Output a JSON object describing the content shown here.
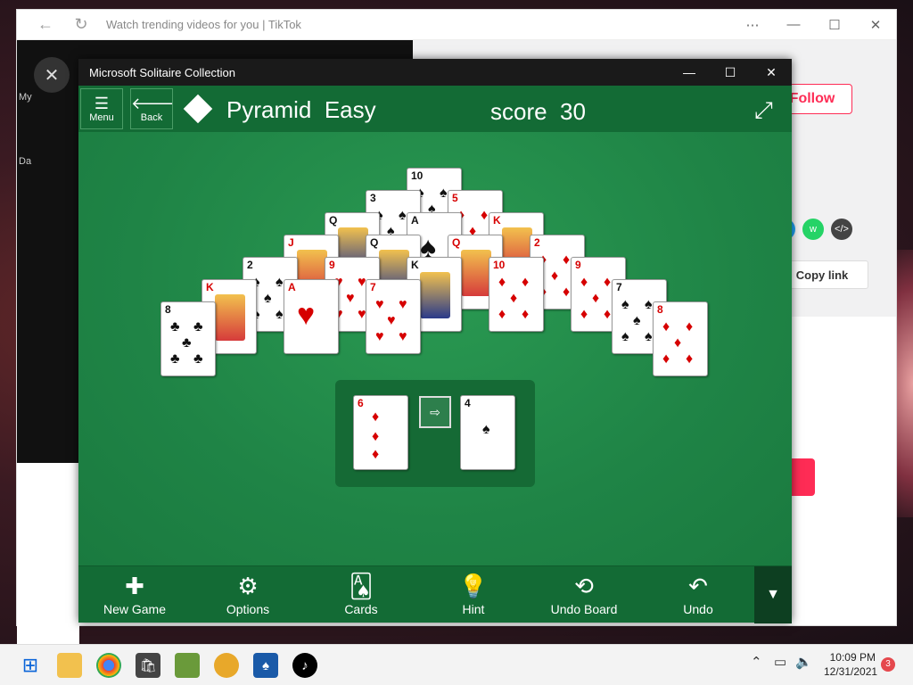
{
  "browser": {
    "title": "Watch trending videos for you | TikTok",
    "more_icon": "⋯",
    "follow_label": "Follow",
    "copy_link_label": "Copy link",
    "left_label_1": "My",
    "left_label_2": "Da"
  },
  "solitaire": {
    "window_title": "Microsoft Solitaire Collection",
    "header": {
      "menu_label": "Menu",
      "back_label": "Back",
      "game_name": "Pyramid",
      "difficulty": "Easy",
      "score_label": "score",
      "score_value": "30"
    },
    "pyramid_cards": [
      {
        "rank": "10",
        "suit": "♠",
        "color": "blk"
      },
      {
        "rank": "3",
        "suit": "♠",
        "color": "blk"
      },
      {
        "rank": "5",
        "suit": "♦",
        "color": "red"
      },
      {
        "rank": "Q",
        "suit": "♠",
        "color": "blk"
      },
      {
        "rank": "A",
        "suit": "♠",
        "color": "blk"
      },
      {
        "rank": "K",
        "suit": "♦",
        "color": "red"
      },
      {
        "rank": "J",
        "suit": "♦",
        "color": "red"
      },
      {
        "rank": "Q",
        "suit": "♠",
        "color": "blk"
      },
      {
        "rank": "Q",
        "suit": "♦",
        "color": "red"
      },
      {
        "rank": "2",
        "suit": "♦",
        "color": "red"
      },
      {
        "rank": "2",
        "suit": "♠",
        "color": "blk"
      },
      {
        "rank": "9",
        "suit": "♥",
        "color": "red"
      },
      {
        "rank": "K",
        "suit": "♠",
        "color": "blk"
      },
      {
        "rank": "10",
        "suit": "♦",
        "color": "red"
      },
      {
        "rank": "9",
        "suit": "♦",
        "color": "red"
      },
      {
        "rank": "K",
        "suit": "♦",
        "color": "red"
      },
      {
        "rank": "A",
        "suit": "♥",
        "color": "red"
      },
      {
        "rank": "7",
        "suit": "♥",
        "color": "red"
      },
      {
        "rank": "7",
        "suit": "♠",
        "color": "blk"
      },
      {
        "rank": "8",
        "suit": "♣",
        "color": "blk"
      },
      {
        "rank": "8",
        "suit": "♦",
        "color": "red"
      }
    ],
    "waste_card": {
      "rank": "6",
      "suit": "♦"
    },
    "stock_card": {
      "rank": "4",
      "suit": "♠"
    },
    "toolbar": {
      "new_game": "New Game",
      "options": "Options",
      "cards": "Cards",
      "hint": "Hint",
      "undo_board": "Undo Board",
      "undo": "Undo"
    }
  },
  "taskbar": {
    "time": "10:09 PM",
    "date": "12/31/2021",
    "notification_count": "3"
  },
  "colors": {
    "felt": "#1f8446",
    "header": "#136b35",
    "tiktok_red": "#fe2c55"
  }
}
